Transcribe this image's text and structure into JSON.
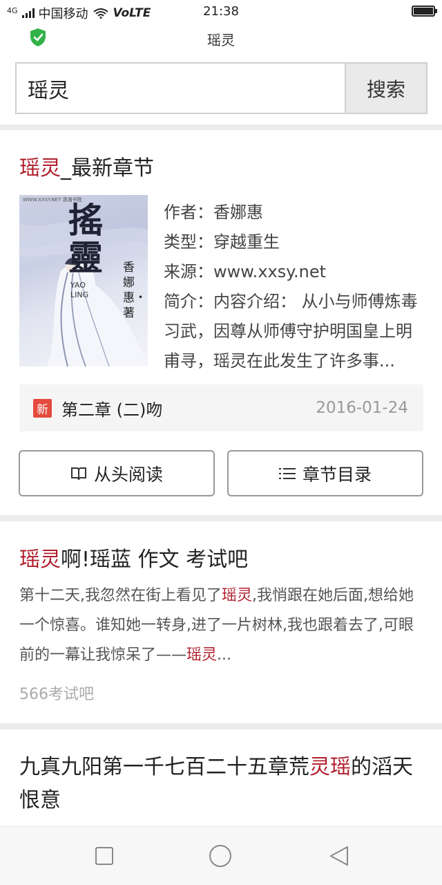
{
  "status_bar": {
    "network": "4G",
    "carrier": "中国移动",
    "volte": "VoLTE",
    "time": "21:38",
    "icons": [
      "signal-icon",
      "wifi-icon",
      "battery-icon"
    ]
  },
  "url_bar": {
    "title": "瑶灵",
    "security_icon": "shield-check-icon",
    "security_color": "#34b24a"
  },
  "search": {
    "query": "瑶灵",
    "button_label": "搜索"
  },
  "book_card": {
    "title_highlight": "瑶灵",
    "title_rest": "_最新章节",
    "cover_text": {
      "site": "WWW.XXSY.NET 潇湘书院",
      "big_title": "搖靈",
      "pinyin_1": "YAO",
      "pinyin_2": "LING",
      "author_line": "香娜惠・著"
    },
    "author_label": "作者：",
    "author": "香娜惠",
    "genre_label": "类型：",
    "genre": "穿越重生",
    "source_label": "来源：",
    "source": "www.xxsy.net",
    "intro_label": "简介：",
    "intro": "内容介绍： 从小与师傅炼毒习武，因尊从师傅守护明国皇上明甫寻，瑶灵在此发生了许多事...",
    "latest_badge": "新",
    "latest_chapter": "第二章 (二)吻",
    "latest_date": "2016-01-24",
    "read_button": "从头阅读",
    "toc_button": "章节目录"
  },
  "result_2": {
    "title_highlight": "瑶灵",
    "title_rest": "啊!瑶蓝 作文 考试吧",
    "snippet_parts": [
      {
        "text": "第十二天,我忽然在街上看见了",
        "hl": false
      },
      {
        "text": "瑶灵",
        "hl": true
      },
      {
        "text": ",我悄跟在她后面,想给她一个惊喜。谁知她一转身,进了一片树林,我也跟着去了,可眼前的一幕让我惊呆了——",
        "hl": false
      },
      {
        "text": "瑶灵",
        "hl": true
      },
      {
        "text": "...",
        "hl": false
      }
    ],
    "source": "566考试吧"
  },
  "result_3": {
    "title_before": "九真九阳第一千七百二十五章荒",
    "title_highlight": "灵瑶",
    "title_after": "的滔天恨意"
  },
  "nav_bar": {
    "icons": [
      "recent-apps-icon",
      "home-icon",
      "back-icon"
    ]
  },
  "colors": {
    "highlight": "#b01e2c",
    "badge": "#e54a3d",
    "separator": "#ececec"
  }
}
